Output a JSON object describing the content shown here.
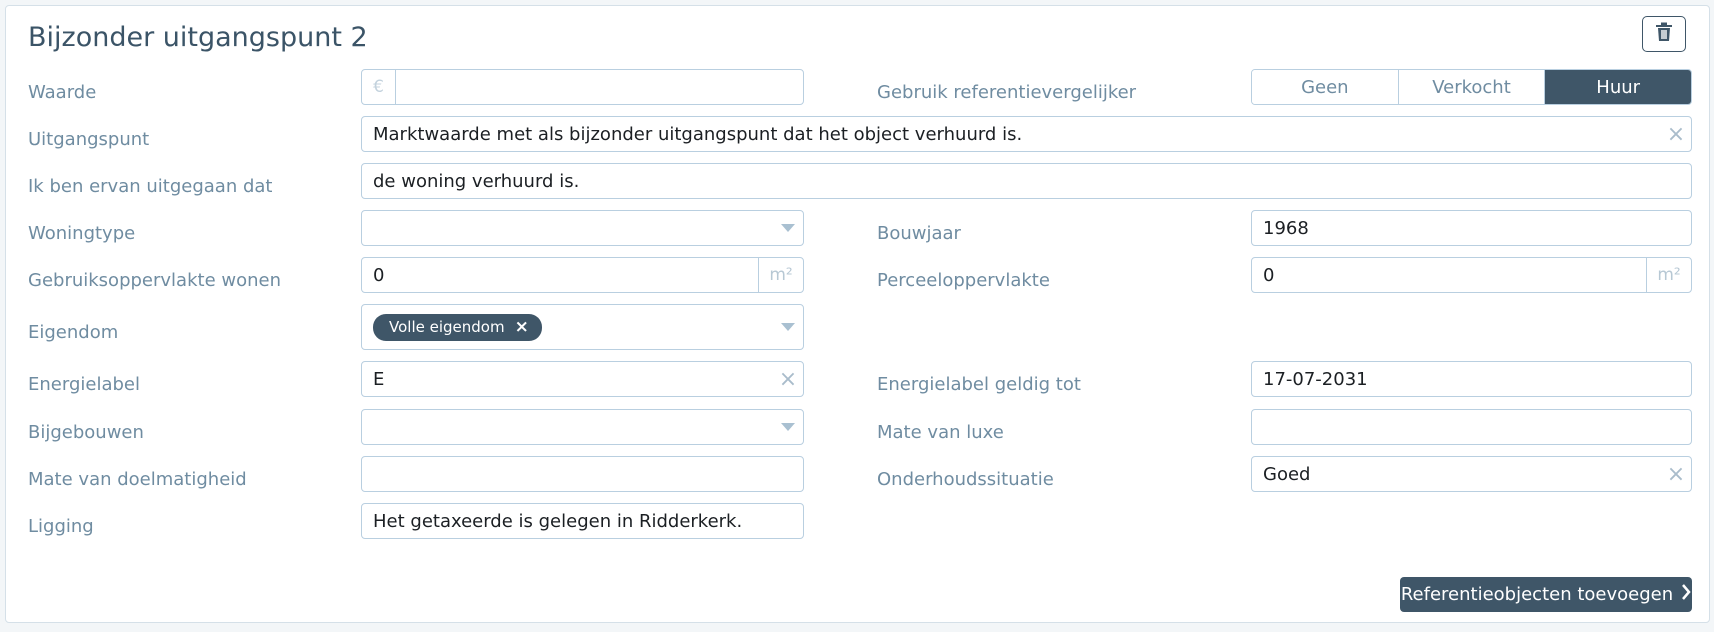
{
  "section": {
    "title": "Bijzonder uitgangspunt 2"
  },
  "icons": {
    "trash": "trash-icon",
    "euro": "€",
    "unit_m2": "m²",
    "clear": "×",
    "caret": "caret-down-icon",
    "chevron": "chevron-right-icon"
  },
  "colors": {
    "accent": "#3f5668",
    "label": "#6f8ca1",
    "border": "#b9cfe0"
  },
  "fields": {
    "waarde": {
      "label": "Waarde",
      "value": ""
    },
    "referentie": {
      "label": "Gebruik referentievergelijker",
      "options": [
        "Geen",
        "Verkocht",
        "Huur"
      ],
      "selected": "Huur"
    },
    "uitgangspunt": {
      "label": "Uitgangspunt",
      "value": "Marktwaarde met als bijzonder uitgangspunt dat het object verhuurd is."
    },
    "uitgegaan": {
      "label": "Ik ben ervan uitgegaan dat",
      "value": "de woning verhuurd is."
    },
    "woningtype": {
      "label": "Woningtype",
      "value": ""
    },
    "bouwjaar": {
      "label": "Bouwjaar",
      "value": "1968"
    },
    "gebruiksoppervlakte": {
      "label": "Gebruiksoppervlakte wonen",
      "value": "0"
    },
    "perceel": {
      "label": "Perceeloppervlakte",
      "value": "0"
    },
    "eigendom": {
      "label": "Eigendom",
      "tag": "Volle eigendom"
    },
    "energielabel": {
      "label": "Energielabel",
      "value": "E"
    },
    "energielabel_tot": {
      "label": "Energielabel geldig tot",
      "value": "17-07-2031"
    },
    "bijgebouwen": {
      "label": "Bijgebouwen",
      "value": ""
    },
    "luxe": {
      "label": "Mate van luxe",
      "value": ""
    },
    "doelmatigheid": {
      "label": "Mate van doelmatigheid",
      "value": ""
    },
    "onderhoud": {
      "label": "Onderhoudssituatie",
      "value": "Goed"
    },
    "ligging": {
      "label": "Ligging",
      "value": "Het getaxeerde is gelegen in Ridderkerk."
    }
  },
  "actions": {
    "add_references": "Referentieobjecten toevoegen"
  }
}
